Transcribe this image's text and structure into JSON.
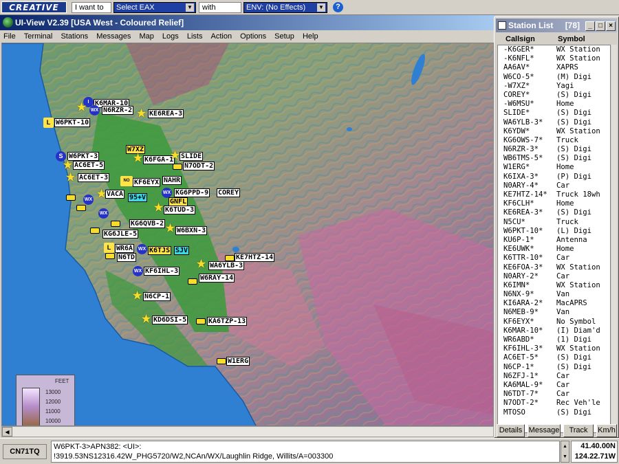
{
  "creative_bar": {
    "logo": "CREATIVE",
    "want_label": "I want to",
    "eax_value": "Select EAX",
    "with_label": "with",
    "env_value": "ENV: (No Effects)"
  },
  "window": {
    "title": "UI-View V2.39 [USA West - Coloured Relief]"
  },
  "menu": [
    "File",
    "Terminal",
    "Stations",
    "Messages",
    "Map",
    "Logs",
    "Lists",
    "Action",
    "Options",
    "Setup",
    "Help"
  ],
  "map": {
    "stations": [
      {
        "label": "K6MAR-10"
      },
      {
        "label": "N6RZR-2"
      },
      {
        "label": "KE6REA-3"
      },
      {
        "label": "W6PKT-10"
      },
      {
        "label": "W7XZ"
      },
      {
        "label": "K6FGA-1"
      },
      {
        "label": "SLIDE"
      },
      {
        "label": "W6PKT-3"
      },
      {
        "label": "AC6ET-5"
      },
      {
        "label": "N7ODT-2"
      },
      {
        "label": "AC6ET-3"
      },
      {
        "label": "KF6EYX"
      },
      {
        "label": "NAHR"
      },
      {
        "label": "KG6PPD-9"
      },
      {
        "label": "COREY"
      },
      {
        "label": "VACA"
      },
      {
        "label": "95+V"
      },
      {
        "label": "GNFL"
      },
      {
        "label": "K6TUD-3"
      },
      {
        "label": "KG6QVB-2"
      },
      {
        "label": "W6BXN-3"
      },
      {
        "label": "KG6JLE-5"
      },
      {
        "label": "WR6A"
      },
      {
        "label": "K6TJS"
      },
      {
        "label": "SJV"
      },
      {
        "label": "N6TD"
      },
      {
        "label": "KE7HTZ-14"
      },
      {
        "label": "WA6YLB-3"
      },
      {
        "label": "KF6IHL-3"
      },
      {
        "label": "W6RAY-14"
      },
      {
        "label": "N6CP-1"
      },
      {
        "label": "KD6DSI-5"
      },
      {
        "label": "KA6TZP-13"
      },
      {
        "label": "W1ERG"
      }
    ],
    "legend": {
      "title": "FEET",
      "levels": [
        "13000",
        "12000",
        "11000",
        "10000"
      ]
    }
  },
  "statusbar": {
    "locator": "CN71TQ",
    "line1": "W6PKT-3>APN382: <UI>:",
    "line2": "!3919.53NS12316.42W_PHG5720/W2,NCAn/WX/Laughlin Ridge, Willits/A=003300",
    "lat": "41.40.00N",
    "lon": "124.22.71W"
  },
  "station_list": {
    "title": "Station List",
    "count": "[78]",
    "col_callsign": "Callsign",
    "col_symbol": "Symbol",
    "rows": [
      {
        "call": "-K6GER*",
        "sym": "WX Station"
      },
      {
        "call": "-K6NFL*",
        "sym": "WX Station"
      },
      {
        "call": "AA6AV*",
        "sym": "XAPRS"
      },
      {
        "call": "W6CO-5*",
        "sym": "(M) Digi"
      },
      {
        "call": "-W7XZ*",
        "sym": "Yagi"
      },
      {
        "call": "COREY*",
        "sym": "(S) Digi"
      },
      {
        "call": "-W6MSU*",
        "sym": "Home"
      },
      {
        "call": "SLIDE*",
        "sym": "(S) Digi"
      },
      {
        "call": "WA6YLB-3*",
        "sym": "(S) Digi"
      },
      {
        "call": "K6YDW*",
        "sym": "WX Station"
      },
      {
        "call": "KG6OWS-7*",
        "sym": "Truck"
      },
      {
        "call": "N6RZR-3*",
        "sym": "(S) Digi"
      },
      {
        "call": "WB6TMS-5*",
        "sym": "(S) Digi"
      },
      {
        "call": "W1ERG*",
        "sym": "Home"
      },
      {
        "call": "K6IXA-3*",
        "sym": "(P) Digi"
      },
      {
        "call": "N0ARY-4*",
        "sym": "Car"
      },
      {
        "call": "KE7HTZ-14*",
        "sym": "Truck 18wh"
      },
      {
        "call": "KF6CLH*",
        "sym": "Home"
      },
      {
        "call": "KE6REA-3*",
        "sym": "(S) Digi"
      },
      {
        "call": "N5CU*",
        "sym": "Truck"
      },
      {
        "call": "W6PKT-10*",
        "sym": "(L) Digi"
      },
      {
        "call": "KU6P-1*",
        "sym": "Antenna"
      },
      {
        "call": "KE6UWK*",
        "sym": "Home"
      },
      {
        "call": "K6TTR-10*",
        "sym": "Car"
      },
      {
        "call": "KE6FOA-3*",
        "sym": "WX Station"
      },
      {
        "call": "N0ARY-2*",
        "sym": "Car"
      },
      {
        "call": "K6IMN*",
        "sym": "WX Station"
      },
      {
        "call": "N6NX-9*",
        "sym": "Van"
      },
      {
        "call": "KI6ARA-2*",
        "sym": "MacAPRS"
      },
      {
        "call": "N6MEB-9*",
        "sym": "Van"
      },
      {
        "call": "KF6EYX*",
        "sym": "No Symbol"
      },
      {
        "call": "K6MAR-10*",
        "sym": "(I) Diam'd"
      },
      {
        "call": "WR6ABD*",
        "sym": "(1) Digi"
      },
      {
        "call": "KF6IHL-3*",
        "sym": "WX Station"
      },
      {
        "call": "AC6ET-5*",
        "sym": "(S) Digi"
      },
      {
        "call": "N6CP-1*",
        "sym": "(S) Digi"
      },
      {
        "call": "N6ZFJ-1*",
        "sym": "Car"
      },
      {
        "call": "KA6MAL-9*",
        "sym": "Car"
      },
      {
        "call": "N6TDT-7*",
        "sym": "Car"
      },
      {
        "call": "N7ODT-2*",
        "sym": "Rec Veh'le"
      },
      {
        "call": "MTOSO",
        "sym": "(S) Digi"
      }
    ],
    "buttons": [
      "Details",
      "Message",
      "Track",
      "Km/h"
    ]
  }
}
